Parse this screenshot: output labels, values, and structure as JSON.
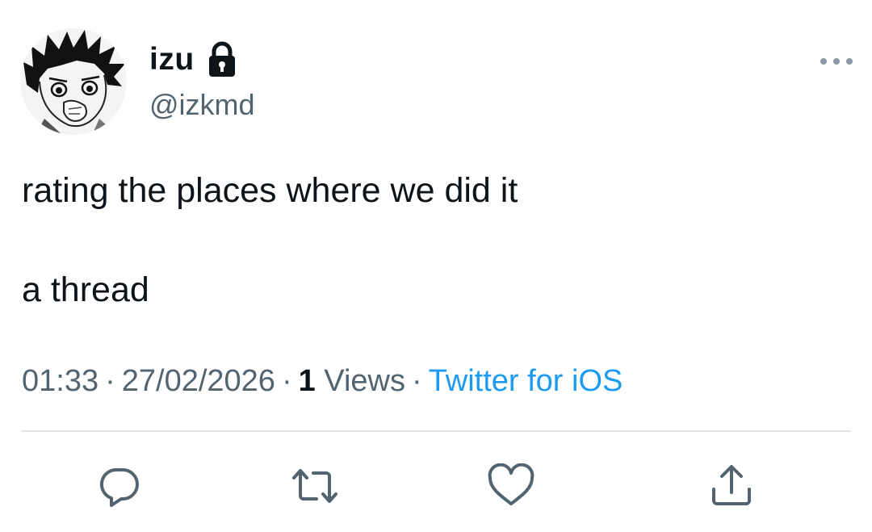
{
  "user": {
    "display_name": "izu",
    "handle": "@izkmd",
    "protected": true
  },
  "tweet": {
    "lines": [
      "rating the places where we did it",
      "a thread"
    ],
    "time": "01:33",
    "date": "27/02/2026",
    "views_count": "1",
    "views_label": "Views",
    "source": "Twitter for iOS",
    "separator": "·"
  },
  "actions": {
    "icons": [
      "reply-icon",
      "retweet-icon",
      "like-icon",
      "share-icon"
    ]
  },
  "colors": {
    "text_primary": "#0f1419",
    "text_secondary": "#536471",
    "link": "#1d9bf0",
    "divider": "#dfe5e8"
  }
}
